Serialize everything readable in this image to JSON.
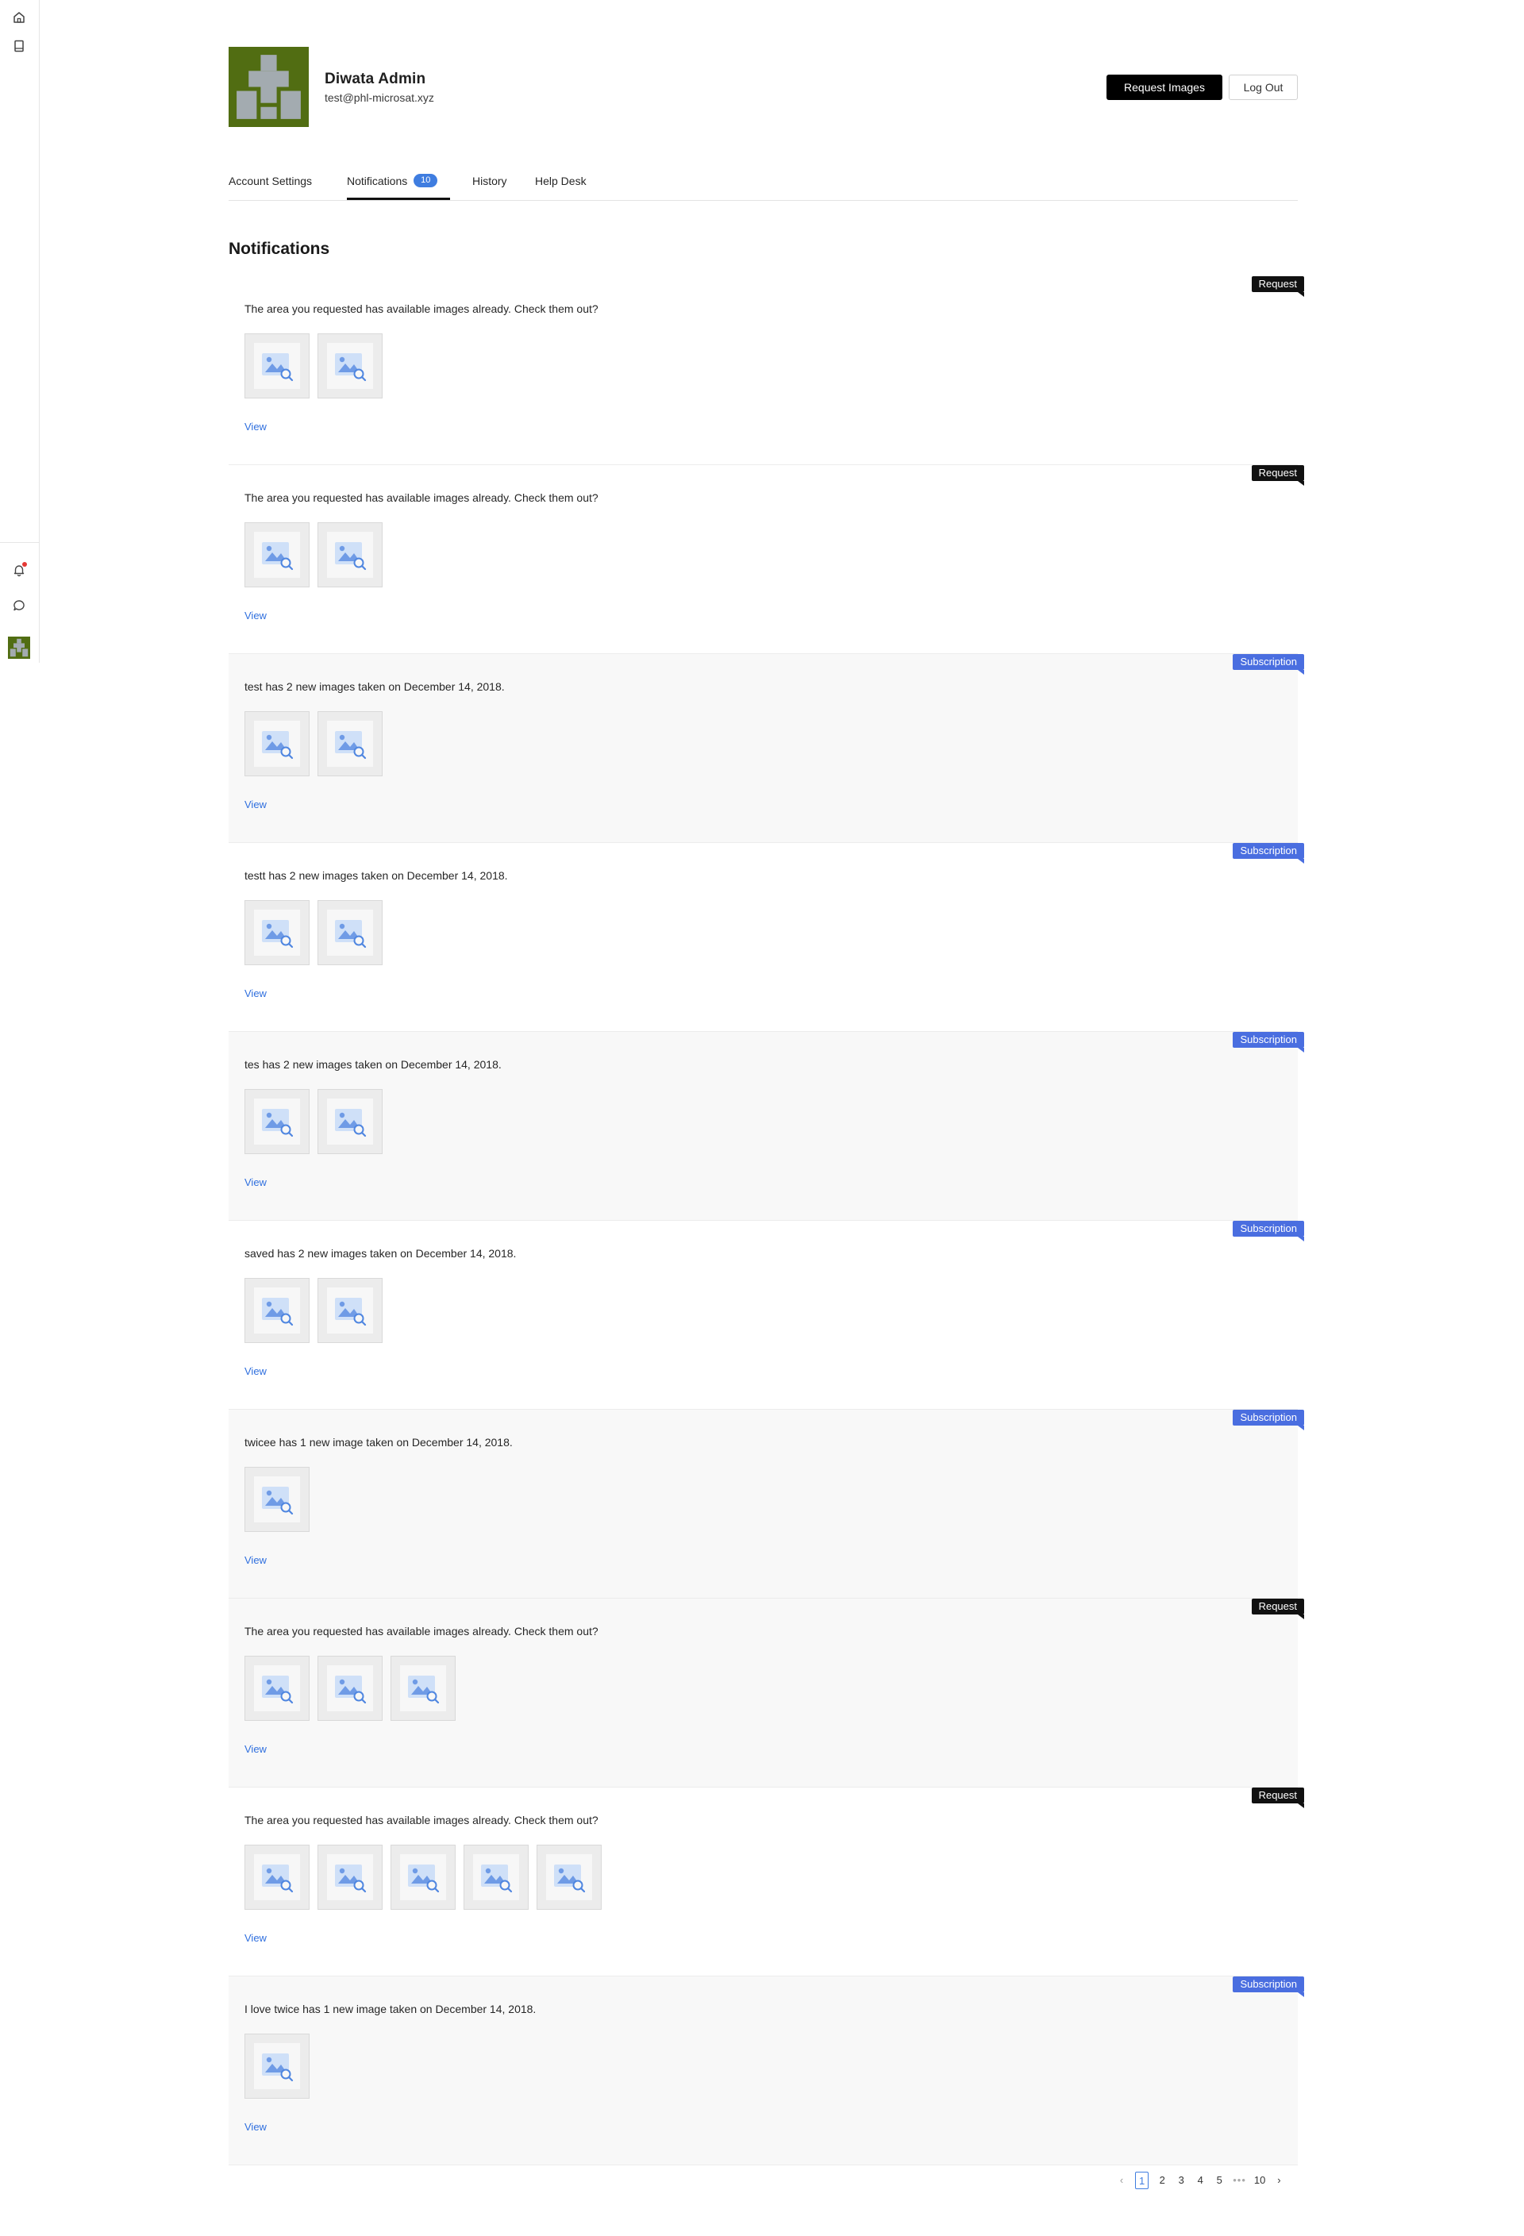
{
  "rail": {
    "icons": [
      "home-icon",
      "book-icon",
      "bell-icon",
      "chat-icon"
    ],
    "notification_dot_color": "#e53935"
  },
  "profile": {
    "name": "Diwata Admin",
    "email": "test@phl-microsat.xyz",
    "request_images_label": "Request Images",
    "logout_label": "Log Out",
    "avatar_colors": {
      "background": "#516d12",
      "figure": "#a3abb0"
    }
  },
  "tabs": [
    {
      "label": "Account Settings"
    },
    {
      "label": "Notifications",
      "badge": "10"
    },
    {
      "label": "History"
    },
    {
      "label": "Help Desk"
    }
  ],
  "section_title": "Notifications",
  "tag_colors": {
    "Request": "#111111",
    "Subscription": "#4a6ee0"
  },
  "notifications": [
    {
      "tag": "Request",
      "message": "The area you requested has available images already. Check them out?",
      "image_count": 2,
      "view_label": "View",
      "alt_bg": false
    },
    {
      "tag": "Request",
      "message": "The area you requested has available images already. Check them out?",
      "image_count": 2,
      "view_label": "View",
      "alt_bg": false
    },
    {
      "tag": "Subscription",
      "message": "test has 2 new images taken on December 14, 2018.",
      "image_count": 2,
      "view_label": "View",
      "alt_bg": true
    },
    {
      "tag": "Subscription",
      "message": "testt has 2 new images taken on December 14, 2018.",
      "image_count": 2,
      "view_label": "View",
      "alt_bg": false
    },
    {
      "tag": "Subscription",
      "message": "tes has 2 new images taken on December 14, 2018.",
      "image_count": 2,
      "view_label": "View",
      "alt_bg": true
    },
    {
      "tag": "Subscription",
      "message": "saved has 2 new images taken on December 14, 2018.",
      "image_count": 2,
      "view_label": "View",
      "alt_bg": false
    },
    {
      "tag": "Subscription",
      "message": "twicee has 1 new image taken on December 14, 2018.",
      "image_count": 1,
      "view_label": "View",
      "alt_bg": true
    },
    {
      "tag": "Request",
      "message": "The area you requested has available images already. Check them out?",
      "image_count": 3,
      "view_label": "View",
      "alt_bg": true
    },
    {
      "tag": "Request",
      "message": "The area you requested has available images already. Check them out?",
      "image_count": 5,
      "view_label": "View",
      "alt_bg": false
    },
    {
      "tag": "Subscription",
      "message": "I love twice has 1 new image taken on December 14, 2018.",
      "image_count": 1,
      "view_label": "View",
      "alt_bg": true
    }
  ],
  "pagination": {
    "pages": [
      "1",
      "2",
      "3",
      "4",
      "5"
    ],
    "current": "1",
    "ellipsis": "•••",
    "last": "10"
  }
}
